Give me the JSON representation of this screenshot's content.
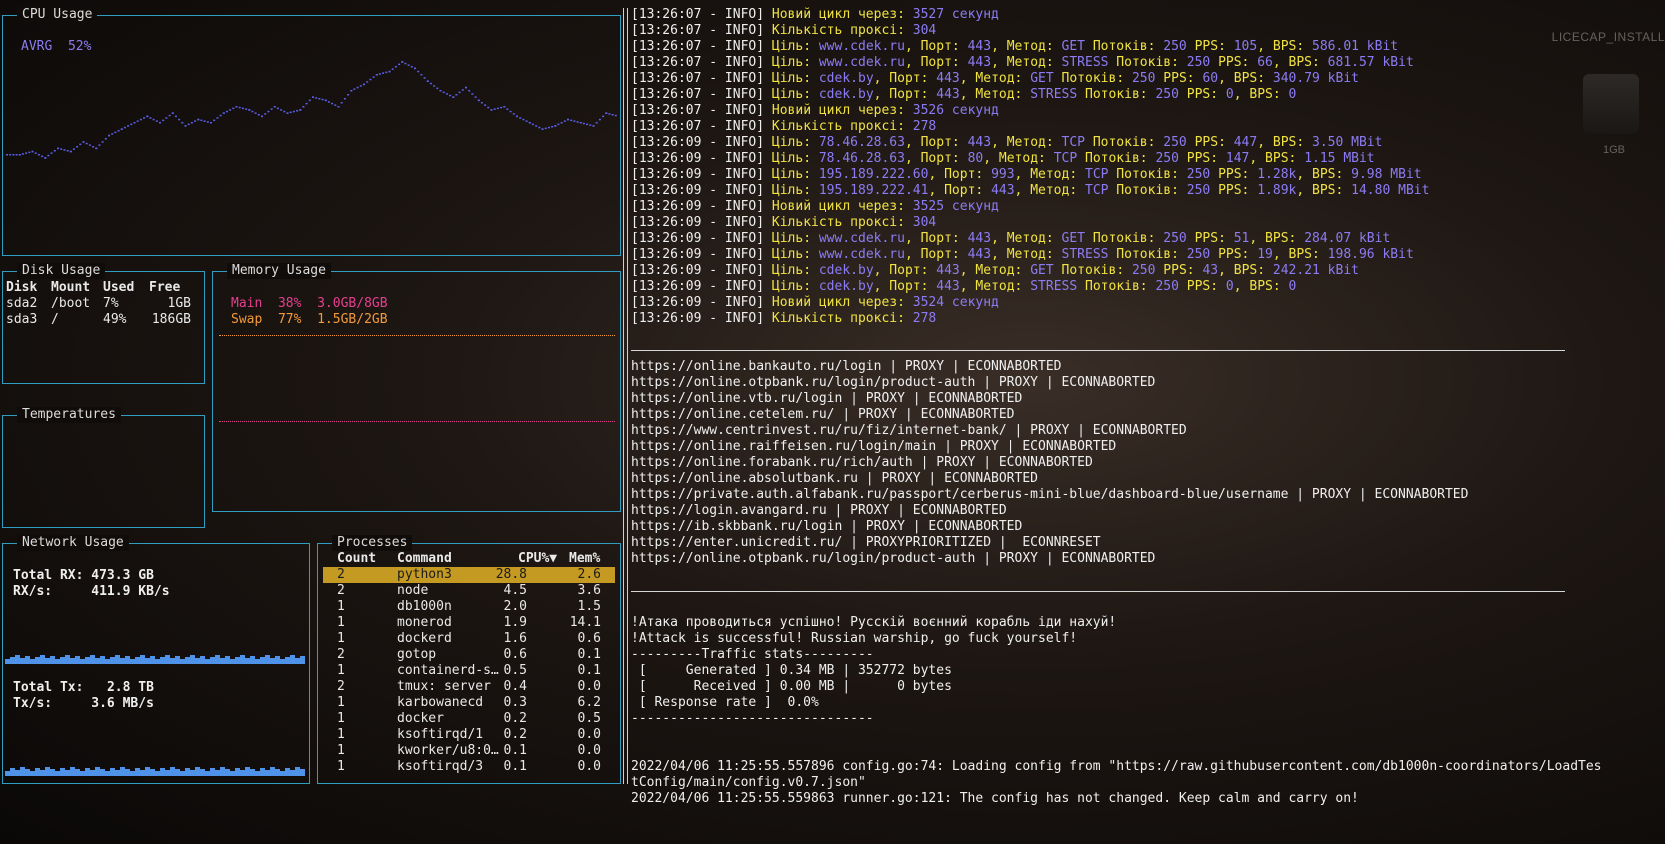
{
  "background_app": {
    "label": "LICECAP_INSTALL",
    "size": "1GB"
  },
  "cpu": {
    "title": "CPU Usage",
    "avg_label": "AVRG",
    "avg_value": "52%",
    "graph": [
      40,
      40,
      41,
      39,
      42,
      41,
      44,
      42,
      46,
      48,
      50,
      52,
      50,
      53,
      49,
      51,
      50,
      53,
      55,
      54,
      52,
      55,
      53,
      54,
      58,
      57,
      55,
      60,
      62,
      65,
      66,
      69,
      67,
      63,
      60,
      58,
      61,
      57,
      54,
      55,
      52,
      50,
      48,
      49,
      51,
      50,
      49,
      53,
      52
    ],
    "graph_fill": "#5a5ee8"
  },
  "disk": {
    "title": "Disk Usage",
    "headers": [
      "Disk",
      "Mount",
      "Used",
      "Free"
    ],
    "rows": [
      [
        "sda2",
        "/boot",
        "7%",
        "1GB"
      ],
      [
        "sda3",
        "/",
        "49%",
        "186GB"
      ]
    ]
  },
  "memory": {
    "title": "Memory Usage",
    "main": {
      "label": "Main",
      "percent": "38%",
      "amount": "3.0GB/8GB"
    },
    "swap": {
      "label": "Swap",
      "percent": "77%",
      "amount": "1.5GB/2GB"
    }
  },
  "temperatures": {
    "title": "Temperatures"
  },
  "network": {
    "title": "Network Usage",
    "total_rx_label": "Total RX:",
    "total_rx": "473.3 GB",
    "rx_rate_label": "RX/s:",
    "rx_rate": "411.9 KB/s",
    "total_tx_label": "Total Tx:",
    "total_tx": "2.8 TB",
    "tx_rate_label": "Tx/s:",
    "tx_rate": "3.6 MB/s",
    "bar_color": "#4f93e8"
  },
  "processes": {
    "title": "Processes",
    "headers": [
      "Count",
      "Command",
      "CPU%▼",
      "Mem%"
    ],
    "rows": [
      [
        "2",
        "python3",
        "28.8",
        "2.6"
      ],
      [
        "2",
        "node",
        "4.5",
        "3.6"
      ],
      [
        "1",
        "db1000n",
        "2.0",
        "1.5"
      ],
      [
        "1",
        "monerod",
        "1.9",
        "14.1"
      ],
      [
        "1",
        "dockerd",
        "1.6",
        "0.6"
      ],
      [
        "2",
        "gotop",
        "0.6",
        "0.1"
      ],
      [
        "1",
        "containerd-s…",
        "0.5",
        "0.1"
      ],
      [
        "2",
        "tmux: server",
        "0.4",
        "0.0"
      ],
      [
        "1",
        "karbowanecd",
        "0.3",
        "6.2"
      ],
      [
        "1",
        "docker",
        "0.2",
        "0.5"
      ],
      [
        "1",
        "ksoftirqd/1",
        "0.2",
        "0.0"
      ],
      [
        "1",
        "kworker/u8:0…",
        "0.1",
        "0.0"
      ],
      [
        "1",
        "ksoftirqd/3",
        "0.1",
        "0.0"
      ]
    ],
    "selected_index": 0
  },
  "logs": [
    {
      "ts": "[13:26:07 - INFO]",
      "kind": "cycle",
      "label": "Новий цикл через:",
      "value": "3527",
      "unit": "секунд"
    },
    {
      "ts": "[13:26:07 - INFO]",
      "kind": "proxy",
      "label": "Кількість проксі:",
      "value": "304"
    },
    {
      "ts": "[13:26:07 - INFO]",
      "kind": "target",
      "target": "www.cdek.ru",
      "port": "443",
      "method": "GET",
      "threads": "250",
      "pps": "105",
      "bps": "586.01 kBit"
    },
    {
      "ts": "[13:26:07 - INFO]",
      "kind": "target",
      "target": "www.cdek.ru",
      "port": "443",
      "method": "STRESS",
      "threads": "250",
      "pps": "66",
      "bps": "681.57 kBit"
    },
    {
      "ts": "[13:26:07 - INFO]",
      "kind": "target",
      "target": "cdek.by",
      "port": "443",
      "method": "GET",
      "threads": "250",
      "pps": "60",
      "bps": "340.79 kBit"
    },
    {
      "ts": "[13:26:07 - INFO]",
      "kind": "target",
      "target": "cdek.by",
      "port": "443",
      "method": "STRESS",
      "threads": "250",
      "pps": "0",
      "bps": "0"
    },
    {
      "ts": "[13:26:07 - INFO]",
      "kind": "cycle",
      "label": "Новий цикл через:",
      "value": "3526",
      "unit": "секунд"
    },
    {
      "ts": "[13:26:07 - INFO]",
      "kind": "proxy",
      "label": "Кількість проксі:",
      "value": "278"
    },
    {
      "ts": "[13:26:09 - INFO]",
      "kind": "target",
      "target": "78.46.28.63",
      "port": "443",
      "method": "TCP",
      "threads": "250",
      "pps": "447",
      "bps": "3.50 MBit"
    },
    {
      "ts": "[13:26:09 - INFO]",
      "kind": "target",
      "target": "78.46.28.63",
      "port": "80",
      "method": "TCP",
      "threads": "250",
      "pps": "147",
      "bps": "1.15 MBit"
    },
    {
      "ts": "[13:26:09 - INFO]",
      "kind": "target",
      "target": "195.189.222.60",
      "port": "993",
      "method": "TCP",
      "threads": "250",
      "pps": "1.28k",
      "bps": "9.98 MBit"
    },
    {
      "ts": "[13:26:09 - INFO]",
      "kind": "target",
      "target": "195.189.222.41",
      "port": "443",
      "method": "TCP",
      "threads": "250",
      "pps": "1.89k",
      "bps": "14.80 MBit"
    },
    {
      "ts": "[13:26:09 - INFO]",
      "kind": "cycle",
      "label": "Новий цикл через:",
      "value": "3525",
      "unit": "секунд"
    },
    {
      "ts": "[13:26:09 - INFO]",
      "kind": "proxy",
      "label": "Кількість проксі:",
      "value": "304"
    },
    {
      "ts": "[13:26:09 - INFO]",
      "kind": "target",
      "target": "www.cdek.ru",
      "port": "443",
      "method": "GET",
      "threads": "250",
      "pps": "51",
      "bps": "284.07 kBit"
    },
    {
      "ts": "[13:26:09 - INFO]",
      "kind": "target",
      "target": "www.cdek.ru",
      "port": "443",
      "method": "STRESS",
      "threads": "250",
      "pps": "19",
      "bps": "198.96 kBit"
    },
    {
      "ts": "[13:26:09 - INFO]",
      "kind": "target",
      "target": "cdek.by",
      "port": "443",
      "method": "GET",
      "threads": "250",
      "pps": "43",
      "bps": "242.21 kBit"
    },
    {
      "ts": "[13:26:09 - INFO]",
      "kind": "target",
      "target": "cdek.by",
      "port": "443",
      "method": "STRESS",
      "threads": "250",
      "pps": "0",
      "bps": "0"
    },
    {
      "ts": "[13:26:09 - INFO]",
      "kind": "cycle",
      "label": "Новий цикл через:",
      "value": "3524",
      "unit": "секунд"
    },
    {
      "ts": "[13:26:09 - INFO]",
      "kind": "proxy",
      "label": "Кількість проксі:",
      "value": "278"
    }
  ],
  "log_labels": {
    "target": "Ціль:",
    "port": "Порт:",
    "method": "Метод:",
    "threads": "Потоків:",
    "pps": "PPS:",
    "bps": "BPS:"
  },
  "urls": [
    "https://online.bankauto.ru/login | PROXY | ECONNABORTED",
    "https://online.otpbank.ru/login/product-auth | PROXY | ECONNABORTED",
    "https://online.vtb.ru/login | PROXY | ECONNABORTED",
    "https://online.cetelem.ru/ | PROXY | ECONNABORTED",
    "https://www.centrinvest.ru/ru/fiz/internet-bank/ | PROXY | ECONNABORTED",
    "https://online.raiffeisen.ru/login/main | PROXY | ECONNABORTED",
    "https://online.forabank.ru/rich/auth | PROXY | ECONNABORTED",
    "https://online.absolutbank.ru | PROXY | ECONNABORTED",
    "https://private.auth.alfabank.ru/passport/cerberus-mini-blue/dashboard-blue/username | PROXY | ECONNABORTED",
    "https://login.avangard.ru | PROXY | ECONNABORTED",
    "https://ib.skbbank.ru/login | PROXY | ECONNABORTED",
    "https://enter.unicredit.ru/ | PROXYPRIORITIZED |  ECONNRESET",
    "https://online.otpbank.ru/login/product-auth | PROXY | ECONNABORTED"
  ],
  "bottom": [
    "!Атака проводиться успішно! Русскій воєнний корабль іди нахуй!",
    "!Attack is successful! Russian warship, go fuck yourself!",
    "---------Traffic stats---------",
    " [     Generated ] 0.34 MB | 352772 bytes",
    " [      Received ] 0.00 MB |      0 bytes",
    " [ Response rate ]  0.0%",
    "-------------------------------",
    "",
    "",
    "2022/04/06 11:25:55.557896 config.go:74: Loading config from \"https://raw.githubusercontent.com/db1000n-coordinators/LoadTes",
    "tConfig/main/config.v0.7.json\"",
    "2022/04/06 11:25:55.559863 runner.go:121: The config has not changed. Keep calm and carry on!"
  ]
}
